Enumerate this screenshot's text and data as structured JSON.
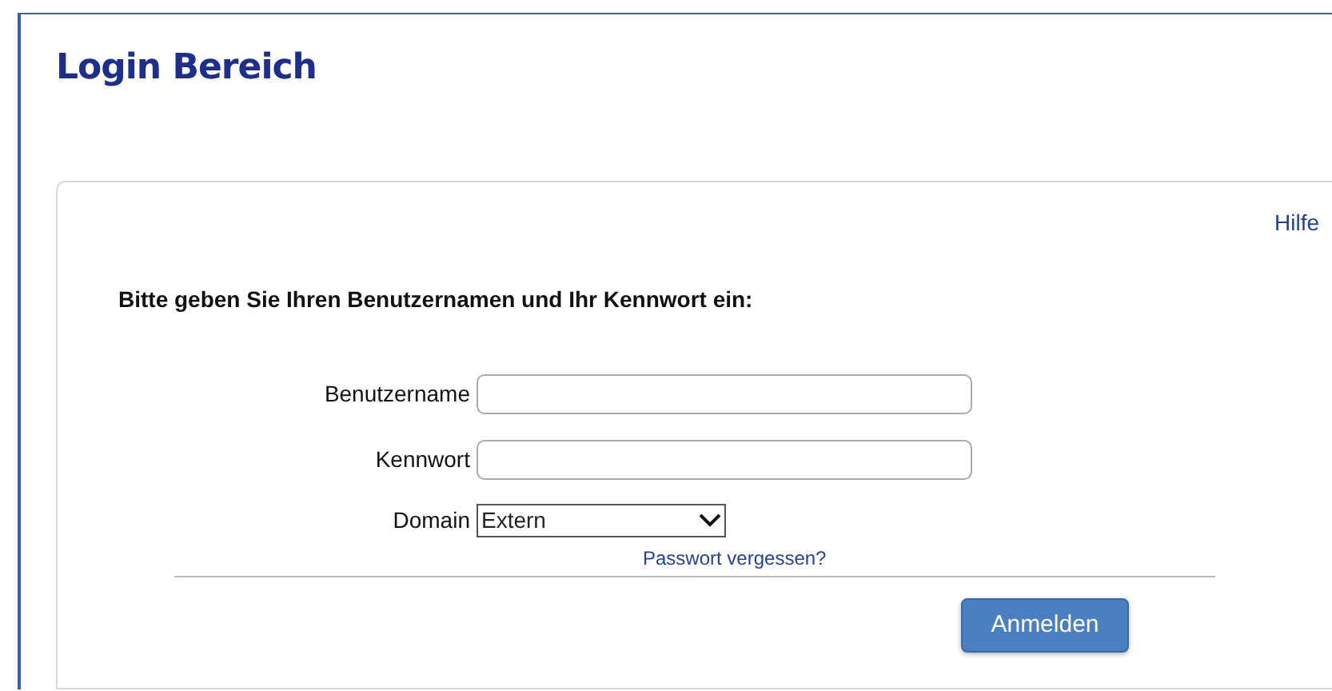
{
  "page": {
    "title": "Login Bereich"
  },
  "help_link": "Hilfe",
  "instruction": "Bitte geben Sie Ihren Benutzernamen und Ihr Kennwort ein:",
  "fields": [
    {
      "kind": "text",
      "label": "Benutzername"
    },
    {
      "kind": "password",
      "label": "Kennwort"
    },
    {
      "kind": "select",
      "label": "Domain",
      "value": "Extern"
    }
  ],
  "forgot_link": "Passwort vergessen?",
  "submit_button": "Anmelden"
}
